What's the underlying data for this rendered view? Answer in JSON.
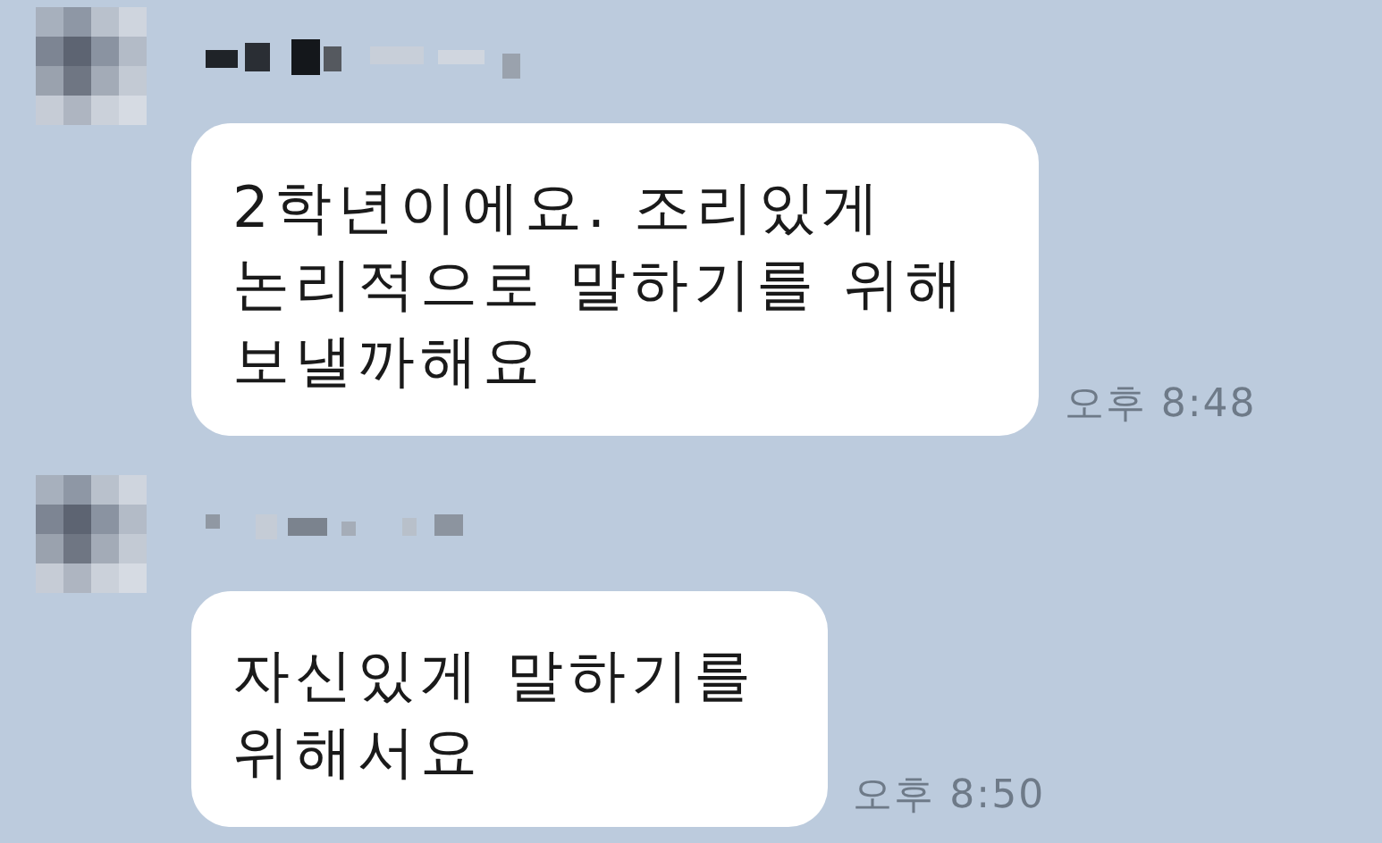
{
  "messages": [
    {
      "text": "2학년이에요. 조리있게\n논리적으로 말하기를 위해\n보낼까해요",
      "time": "오후 8:48"
    },
    {
      "text": "자신있게 말하기를\n위해서요",
      "time": "오후 8:50"
    }
  ]
}
